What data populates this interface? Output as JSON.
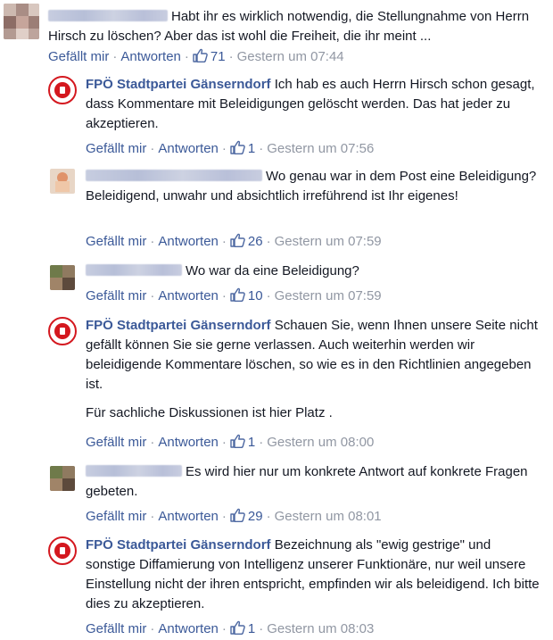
{
  "labels": {
    "like": "Gefällt mir",
    "reply": "Antworten"
  },
  "page_name": "FPÖ Stadtpartei Gänserndorf",
  "comments": [
    {
      "text": "Habt ihr es wirklich notwendig, die Stellungnahme von Herrn Hirsch zu löschen? Aber das ist wohl die Freiheit, die ihr meint ...",
      "likes": "71",
      "time": "Gestern um 07:44"
    },
    {
      "text": "Ich hab es auch Herrn Hirsch schon gesagt, dass Kommentare mit Beleidigungen gelöscht werden. Das hat jeder zu akzeptieren.",
      "likes": "1",
      "time": "Gestern um 07:56"
    },
    {
      "text": "Wo genau war in dem Post eine Beleidigung? Beleidigend, unwahr und absichtlich irreführend ist Ihr eigenes!",
      "likes": "26",
      "time": "Gestern um 07:59"
    },
    {
      "text": "Wo war da eine Beleidigung?",
      "likes": "10",
      "time": "Gestern um 07:59"
    },
    {
      "text": "Schauen Sie, wenn Ihnen unsere Seite nicht gefällt können Sie sie gerne verlassen. Auch weiterhin werden wir beleidigende Kommentare löschen, so wie es in den Richtlinien angegeben ist.",
      "text2": "Für sachliche Diskussionen ist hier Platz .",
      "likes": "1",
      "time": "Gestern um 08:00"
    },
    {
      "text": "Es wird hier nur um konkrete Antwort auf konkrete Fragen gebeten.",
      "likes": "29",
      "time": "Gestern um 08:01"
    },
    {
      "text": "Bezeichnung als \"ewig gestrige\" und sonstige Diffamierung von Intelligenz unserer Funktionäre, nur weil unsere Einstellung nicht der ihren entspricht, empfinden wir als beleidigend. Ich bitte dies zu akzeptieren.",
      "likes": "1",
      "time": "Gestern um 08:03"
    }
  ]
}
